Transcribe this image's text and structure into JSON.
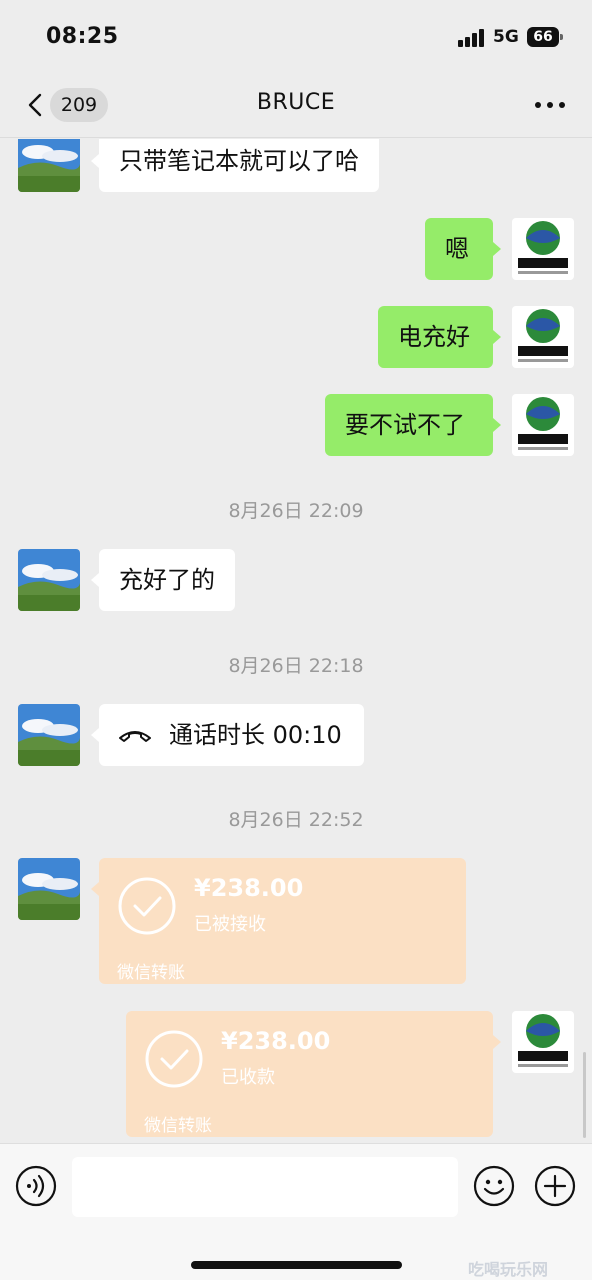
{
  "status_bar": {
    "time": "08:25",
    "network": "5G",
    "battery": "66"
  },
  "nav": {
    "unread_count": "209",
    "title": "BRUCE",
    "more_icon": "more-dots-icon"
  },
  "messages": {
    "m1": {
      "text": "只带笔记本就可以了哈"
    },
    "m2": {
      "text": "嗯"
    },
    "m3": {
      "text": "电充好"
    },
    "m4": {
      "text": "要不试不了"
    },
    "ts1": {
      "text": "8月26日 22:09"
    },
    "m5": {
      "text": "充好了的"
    },
    "ts2": {
      "text": "8月26日 22:18"
    },
    "m6": {
      "text": "通话时长 00:10",
      "icon": "phone-hangup-icon"
    },
    "ts3": {
      "text": "8月26日 22:52"
    },
    "t1": {
      "amount": "¥238.00",
      "status": "已被接收",
      "footer": "微信转账"
    },
    "t2": {
      "amount": "¥238.00",
      "status": "已收款",
      "footer": "微信转账"
    }
  },
  "input_bar": {
    "placeholder": ""
  },
  "watermark": "吃喝玩乐网",
  "colors": {
    "background": "#ededed",
    "outgoing_bubble": "#95ec69",
    "incoming_bubble": "#ffffff",
    "transfer_bubble": "#fbe0c4",
    "timestamp": "#999999"
  }
}
